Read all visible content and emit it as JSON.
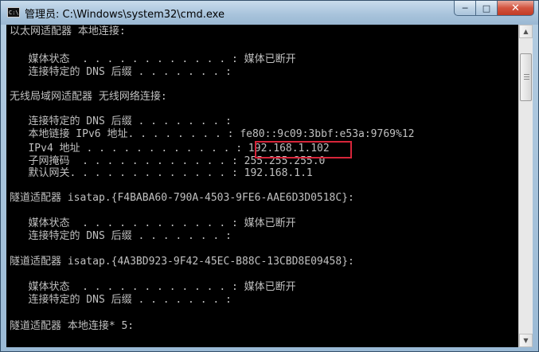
{
  "window": {
    "title": "管理员: C:\\Windows\\system32\\cmd.exe",
    "icon_text": "C:\\",
    "buttons": {
      "minimize": "─",
      "maximize": "□",
      "close": "✕"
    }
  },
  "console": {
    "lines": [
      "以太网适配器 本地连接:",
      "",
      "   媒体状态  . . . . . . . . . . . . : 媒体已断开",
      "   连接特定的 DNS 后缀 . . . . . . . :",
      "",
      "无线局域网适配器 无线网络连接:",
      "",
      "   连接特定的 DNS 后缀 . . . . . . . :",
      "   本地链接 IPv6 地址. . . . . . . . : fe80::9c09:3bbf:e53a:9769%12",
      "   IPv4 地址 . . . . . . . . . . . . : 192.168.1.102",
      "   子网掩码  . . . . . . . . . . . . : 255.255.255.0",
      "   默认网关. . . . . . . . . . . . . : 192.168.1.1",
      "",
      "隧道适配器 isatap.{F4BABA60-790A-4503-9FE6-AAE6D3D0518C}:",
      "",
      "   媒体状态  . . . . . . . . . . . . : 媒体已断开",
      "   连接特定的 DNS 后缀 . . . . . . . :",
      "",
      "隧道适配器 isatap.{4A3BD923-9F42-45EC-B88C-13CBD8E09458}:",
      "",
      "   媒体状态  . . . . . . . . . . . . : 媒体已断开",
      "   连接特定的 DNS 后缀 . . . . . . . :",
      "",
      "隧道适配器 本地连接* 5:"
    ],
    "highlight_color": "#d6253a"
  },
  "scrollbar": {
    "up_arrow": "▲",
    "down_arrow": "▼"
  }
}
